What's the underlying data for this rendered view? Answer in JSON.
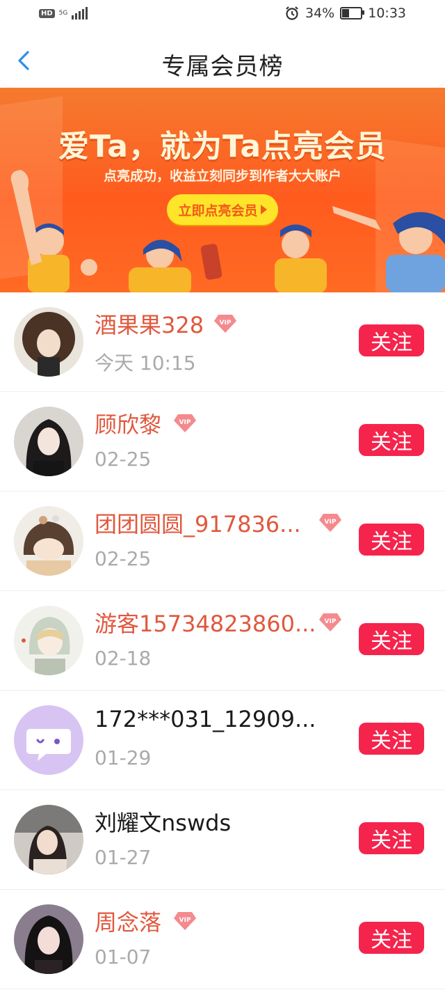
{
  "status_bar": {
    "hd": "HD",
    "network": "5G",
    "battery": "34%",
    "time": "10:33"
  },
  "header": {
    "title": "专属会员榜"
  },
  "banner": {
    "headline": "爱Ta，就为Ta点亮会员",
    "subline": "点亮成功，收益立刻同步到作者大大账户",
    "cta": "立即点亮会员"
  },
  "members": [
    {
      "name": "酒果果328",
      "date": "今天 10:15",
      "vip": true,
      "follow": "关注"
    },
    {
      "name": "顾欣黎",
      "date": "02-25",
      "vip": true,
      "follow": "关注"
    },
    {
      "name": "团团圆圆_917836...",
      "date": "02-25",
      "vip": true,
      "follow": "关注"
    },
    {
      "name": "游客15734823860...",
      "date": "02-18",
      "vip": true,
      "follow": "关注"
    },
    {
      "name": "172***031_12909...",
      "date": "01-29",
      "vip": false,
      "follow": "关注"
    },
    {
      "name": "刘耀文nswds",
      "date": "01-27",
      "vip": false,
      "follow": "关注"
    },
    {
      "name": "周念落",
      "date": "01-07",
      "vip": true,
      "follow": "关注"
    }
  ],
  "colors": {
    "accent": "#f5244d",
    "vip_name": "#e0583e",
    "back_arrow": "#2a8fe8",
    "banner": "#ff5b1e"
  }
}
